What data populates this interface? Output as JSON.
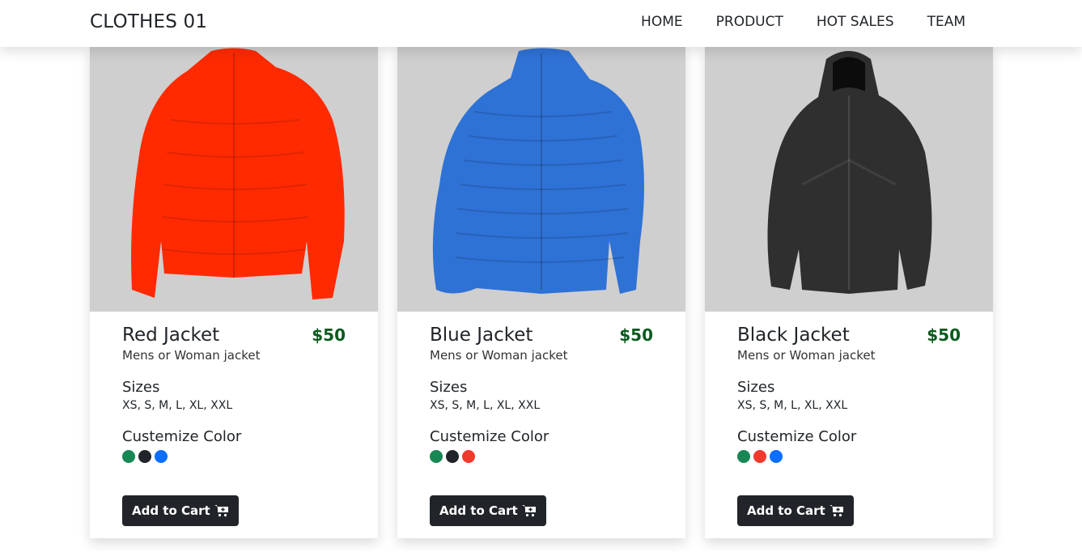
{
  "navbar": {
    "brand": "CLOTHES 01",
    "links": [
      "HOME",
      "PRODUCT",
      "HOT SALES",
      "TEAM"
    ]
  },
  "products": [
    {
      "title": "Red Jacket",
      "price": "$50",
      "subtitle": "Mens or Woman jacket",
      "sizes_heading": "Sizes",
      "sizes": "XS, S, M, L, XL, XXL",
      "color_heading": "Custemize Color",
      "swatches": [
        "#198754",
        "#212529",
        "#0d6efd"
      ],
      "button_label": "Add to Cart",
      "jacket_color": "#ff2a00",
      "button_icon": "cart-plus-icon"
    },
    {
      "title": "Blue Jacket",
      "price": "$50",
      "subtitle": "Mens or Woman jacket",
      "sizes_heading": "Sizes",
      "sizes": "XS, S, M, L, XL, XXL",
      "color_heading": "Custemize Color",
      "swatches": [
        "#198754",
        "#212529",
        "#f03a2e"
      ],
      "button_label": "Add to Cart",
      "jacket_color": "#2f72d6",
      "button_icon": "cart-plus-icon"
    },
    {
      "title": "Black Jacket",
      "price": "$50",
      "subtitle": "Mens or Woman jacket",
      "sizes_heading": "Sizes",
      "sizes": "XS, S, M, L, XL, XXL",
      "color_heading": "Custemize Color",
      "swatches": [
        "#198754",
        "#f03a2e",
        "#0d6efd"
      ],
      "button_label": "Add to Cart",
      "jacket_color": "#2f2f2f",
      "button_icon": "cart-plus-icon"
    }
  ]
}
